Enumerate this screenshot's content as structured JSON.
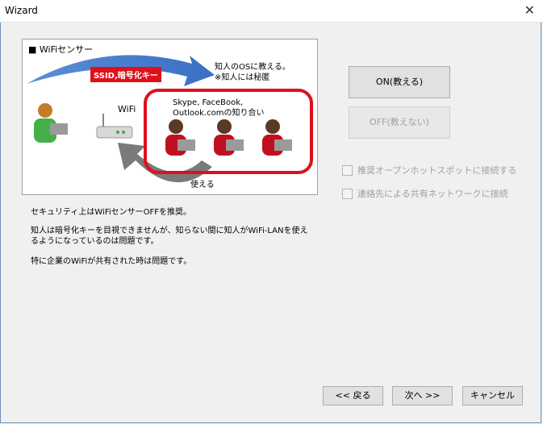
{
  "window": {
    "title": "Wizard",
    "close_symbol": "✕"
  },
  "illustration": {
    "title": "■ WiFiセンサー",
    "ssid_label": "SSID,暗号化キー",
    "tell_label": "知人のOSに教える。\n※知人には秘匿",
    "wifi_label": "WiFi",
    "friends_label": "Skype, FaceBook,\nOutlook.comの知り合い",
    "use_label": "使える"
  },
  "buttons": {
    "on": "ON(教える)",
    "off": "OFF(教えない)"
  },
  "checkboxes": [
    {
      "label": "推奨オープンホットスポットに接続する",
      "checked": false
    },
    {
      "label": "連絡先による共有ネットワークに接続",
      "checked": false
    }
  ],
  "text": {
    "line1": "セキュリティ上はWiFiセンサーOFFを推奨。",
    "line2": "知人は暗号化キーを目視できませんが、知らない間に知人がWiFi-LANを使え\nるようになっているのは問題です。",
    "line3": "特に企業のWiFiが共有された時は問題です。"
  },
  "nav": {
    "back": "<< 戻る",
    "next": "次へ >>",
    "cancel": "キャンセル"
  }
}
